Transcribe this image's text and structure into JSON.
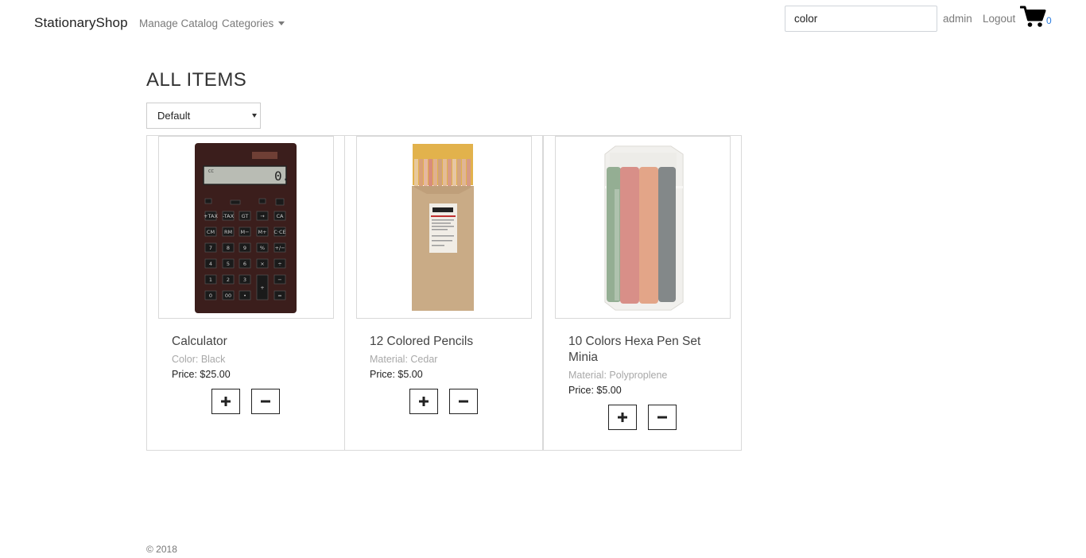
{
  "navbar": {
    "brand": "StationaryShop",
    "manage_catalog": "Manage Catalog",
    "categories": "Categories",
    "search_value": "color",
    "admin": "admin",
    "logout": "Logout",
    "cart_count": "0",
    "cart_icon": "shopping-cart-icon"
  },
  "main": {
    "title": "ALL ITEMS",
    "sort_selected": "Default"
  },
  "items": [
    {
      "name": "Calculator",
      "attribute": "Color: Black",
      "price": "Price: $25.00",
      "image": "calculator-image"
    },
    {
      "name": "12 Colored Pencils",
      "attribute": "Material: Cedar",
      "price": "Price: $5.00",
      "image": "colored-pencils-image"
    },
    {
      "name": "10 Colors Hexa Pen Set Minia",
      "attribute": "Material: Polyproplene",
      "price": "Price: $5.00",
      "image": "hexa-pen-set-image"
    }
  ],
  "footer": {
    "copyright": "© 2018"
  },
  "colors": {
    "accent": "#2a7de1",
    "border": "#d9d9d9",
    "muted_text": "#a8a8a8"
  }
}
